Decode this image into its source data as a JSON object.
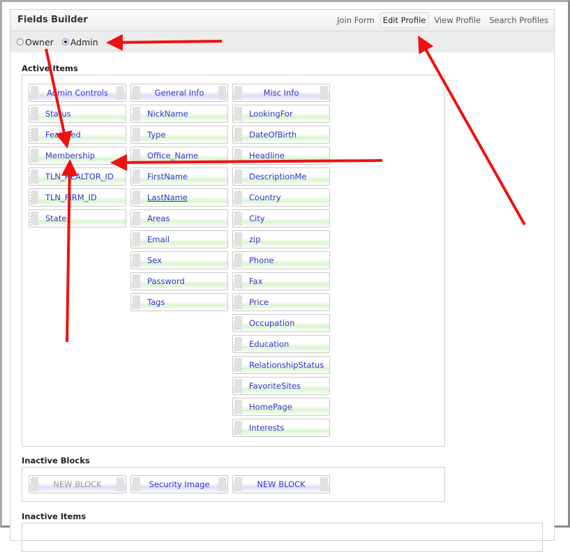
{
  "header": {
    "title": "Fields Builder",
    "tabs": [
      "Join Form",
      "Edit Profile",
      "View Profile",
      "Search Profiles"
    ],
    "active_tab": "Edit Profile"
  },
  "radio": {
    "options": [
      "Owner",
      "Admin"
    ],
    "selected": "Admin"
  },
  "active_items": {
    "label": "Active Items",
    "columns": [
      {
        "block": "Admin Controls",
        "items": [
          "Status",
          "Featured",
          "Membership",
          "TLN_REALTOR_ID",
          "TLN_FIRM_ID",
          "State"
        ]
      },
      {
        "block": "General Info",
        "items": [
          "NickName",
          "Type",
          "Office_Name",
          "FirstName",
          "LastName",
          "Areas",
          "Email",
          "Sex",
          "Password",
          "Tags"
        ]
      },
      {
        "block": "Misc Info",
        "items": [
          "LookingFor",
          "DateOfBirth",
          "Headline",
          "DescriptionMe",
          "Country",
          "City",
          "zip",
          "Phone",
          "Fax",
          "Price",
          "Occupation",
          "Education",
          "RelationshipStatus",
          "FavoriteSites",
          "HomePage",
          "Interests"
        ]
      }
    ]
  },
  "inactive_blocks": {
    "label": "Inactive Blocks",
    "items": [
      "NEW BLOCK",
      "Security Image",
      "NEW BLOCK"
    ]
  },
  "inactive_items": {
    "label": "Inactive Items"
  },
  "colors": {
    "annotation_arrow": "#ee1111",
    "link": "#3333cc"
  }
}
